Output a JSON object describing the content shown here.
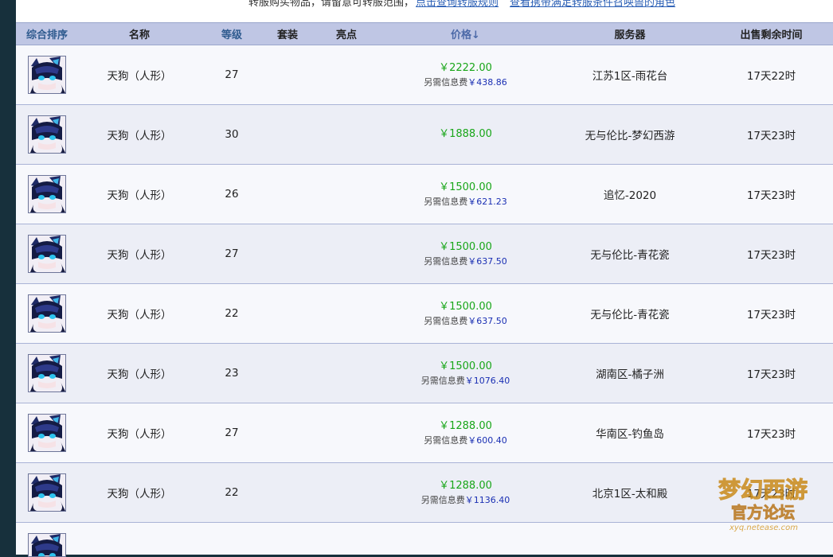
{
  "notice": {
    "text": "转服购买物品，请留意可转服范围，",
    "link1": "点击查询转服规则",
    "link2": "查看携带满足转服条件召唤兽的角色"
  },
  "columns": {
    "composite_sort": "综合排序",
    "name": "名称",
    "level": "等级",
    "set": "套装",
    "highlight": "亮点",
    "price": "价格",
    "price_sort_icon": "↓",
    "server": "服务器",
    "time_left": "出售剩余时间"
  },
  "fee_label": "另需信息费",
  "rows": [
    {
      "name": "天狗（人形）",
      "level": "27",
      "price": "￥2222.00",
      "fee": "￥438.86",
      "server": "江苏1区-雨花台",
      "time": "17天22时"
    },
    {
      "name": "天狗（人形）",
      "level": "30",
      "price": "￥1888.00",
      "fee": "",
      "server": "无与伦比-梦幻西游",
      "time": "17天23时"
    },
    {
      "name": "天狗（人形）",
      "level": "26",
      "price": "￥1500.00",
      "fee": "￥621.23",
      "server": "追忆-2020",
      "time": "17天23时"
    },
    {
      "name": "天狗（人形）",
      "level": "27",
      "price": "￥1500.00",
      "fee": "￥637.50",
      "server": "无与伦比-青花瓷",
      "time": "17天23时"
    },
    {
      "name": "天狗（人形）",
      "level": "22",
      "price": "￥1500.00",
      "fee": "￥637.50",
      "server": "无与伦比-青花瓷",
      "time": "17天23时"
    },
    {
      "name": "天狗（人形）",
      "level": "23",
      "price": "￥1500.00",
      "fee": "￥1076.40",
      "server": "湖南区-橘子洲",
      "time": "17天23时"
    },
    {
      "name": "天狗（人形）",
      "level": "27",
      "price": "￥1288.00",
      "fee": "￥600.40",
      "server": "华南区-钓鱼岛",
      "time": "17天23时"
    },
    {
      "name": "天狗（人形）",
      "level": "22",
      "price": "￥1288.00",
      "fee": "￥1136.40",
      "server": "北京1区-太和殿",
      "time": "17天23时"
    }
  ],
  "watermark": {
    "line1": "梦幻西游",
    "line2": "官方论坛",
    "url": "xyq.netease.com"
  }
}
